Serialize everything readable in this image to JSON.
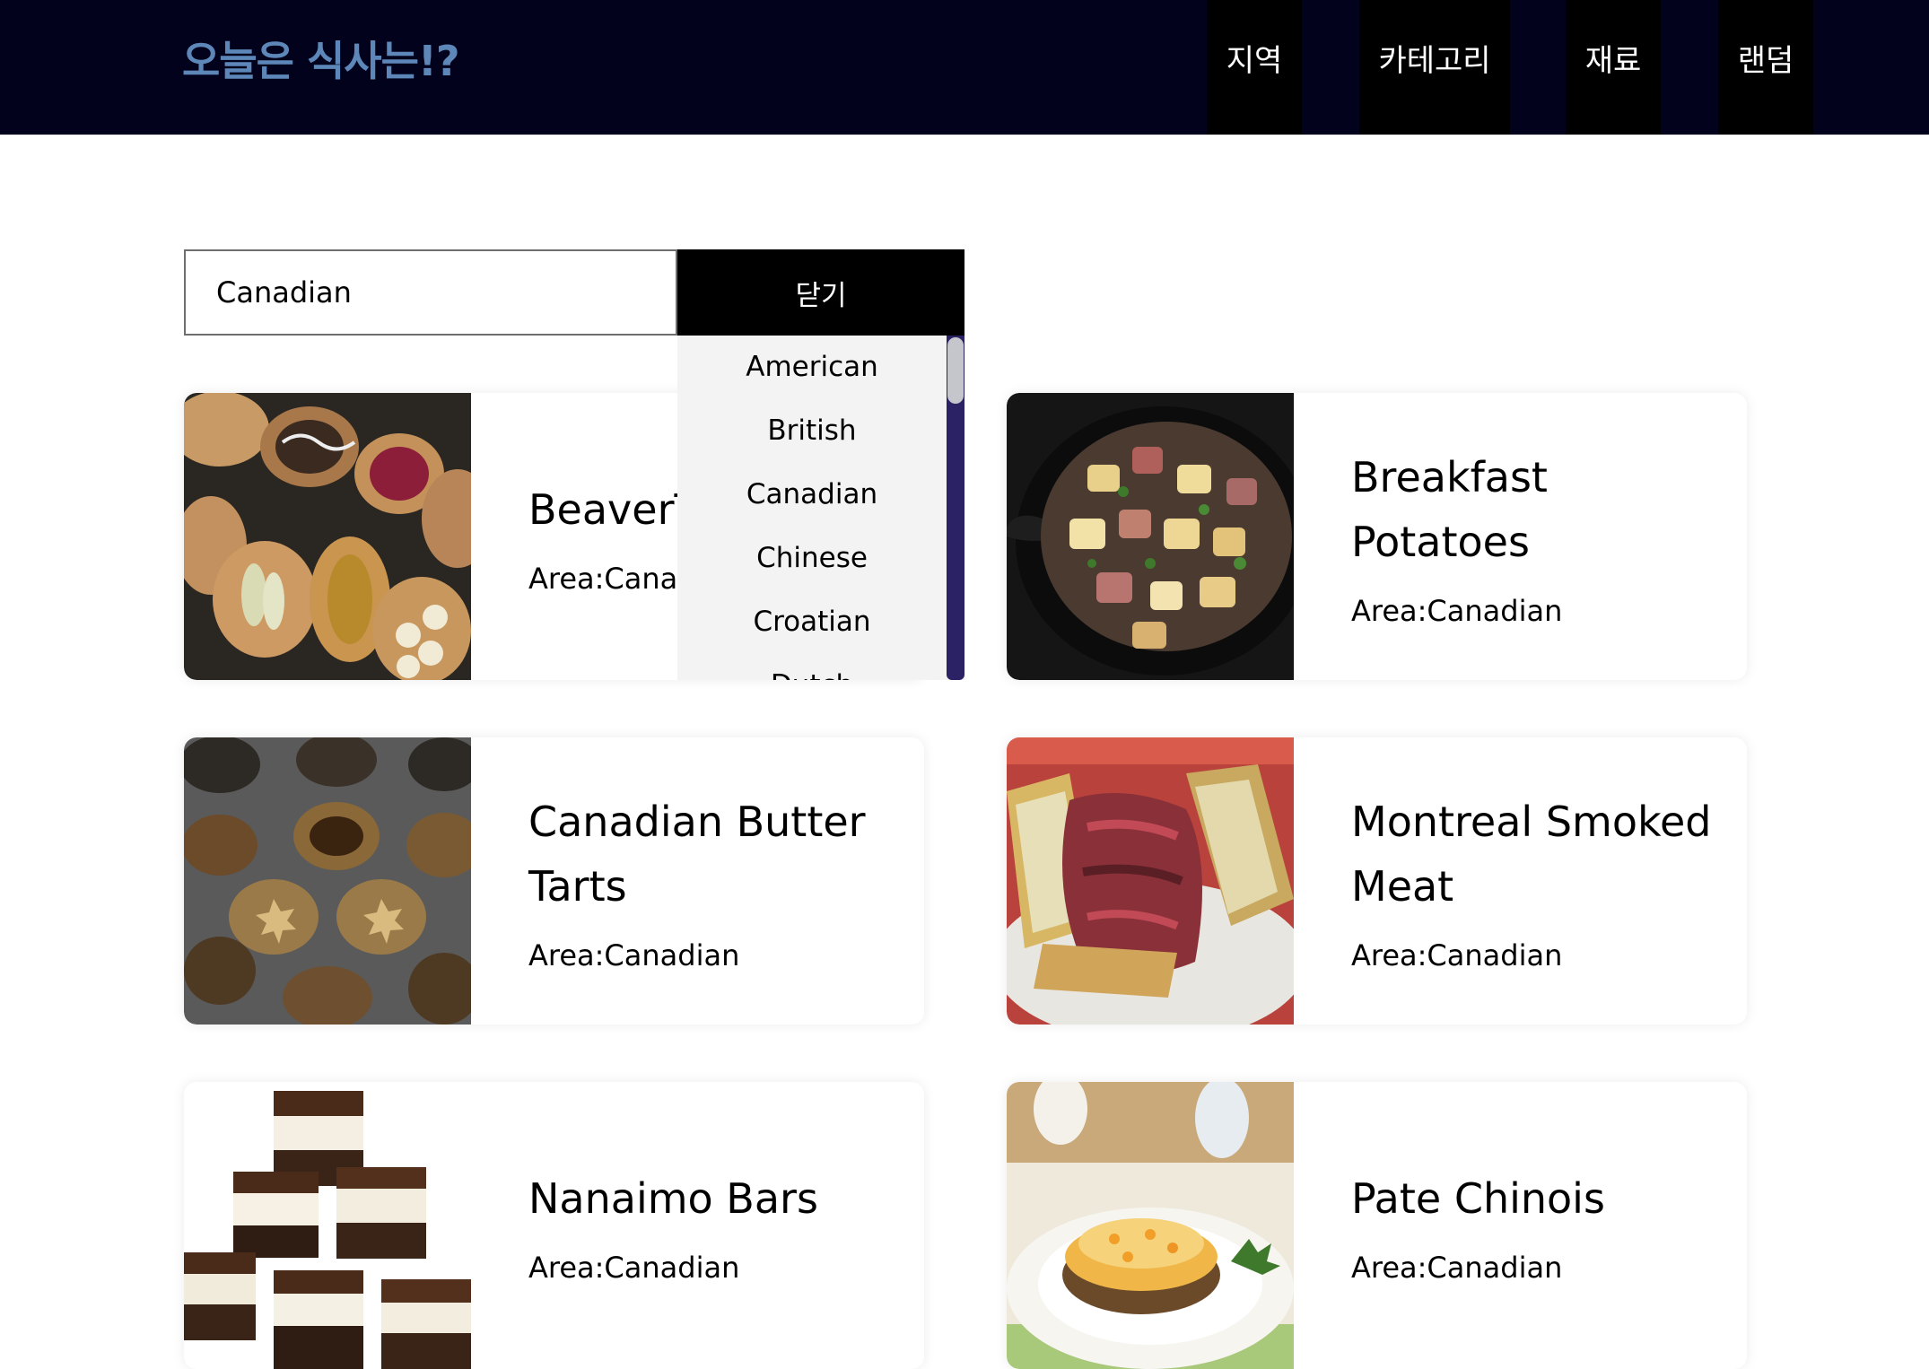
{
  "header": {
    "logo": "오늘은 식사는!?",
    "nav": [
      {
        "label": "지역"
      },
      {
        "label": "카테고리"
      },
      {
        "label": "재료"
      },
      {
        "label": "랜덤"
      }
    ]
  },
  "search": {
    "value": "Canadian",
    "close_label": "닫기",
    "options": [
      "American",
      "British",
      "Canadian",
      "Chinese",
      "Croatian",
      "Dutch"
    ]
  },
  "area_prefix": "Area:",
  "meals": [
    {
      "title": "BeaverTails",
      "area": "Canadian",
      "image": "beavertails-photo"
    },
    {
      "title": "Breakfast Potatoes",
      "area": "Canadian",
      "image": "breakfast-potatoes-photo"
    },
    {
      "title": "Canadian Butter Tarts",
      "area": "Canadian",
      "image": "butter-tarts-photo"
    },
    {
      "title": "Montreal Smoked Meat",
      "area": "Canadian",
      "image": "smoked-meat-photo"
    },
    {
      "title": "Nanaimo Bars",
      "area": "Canadian",
      "image": "nanaimo-bars-photo"
    },
    {
      "title": "Pate Chinois",
      "area": "Canadian",
      "image": "pate-chinois-photo"
    }
  ]
}
